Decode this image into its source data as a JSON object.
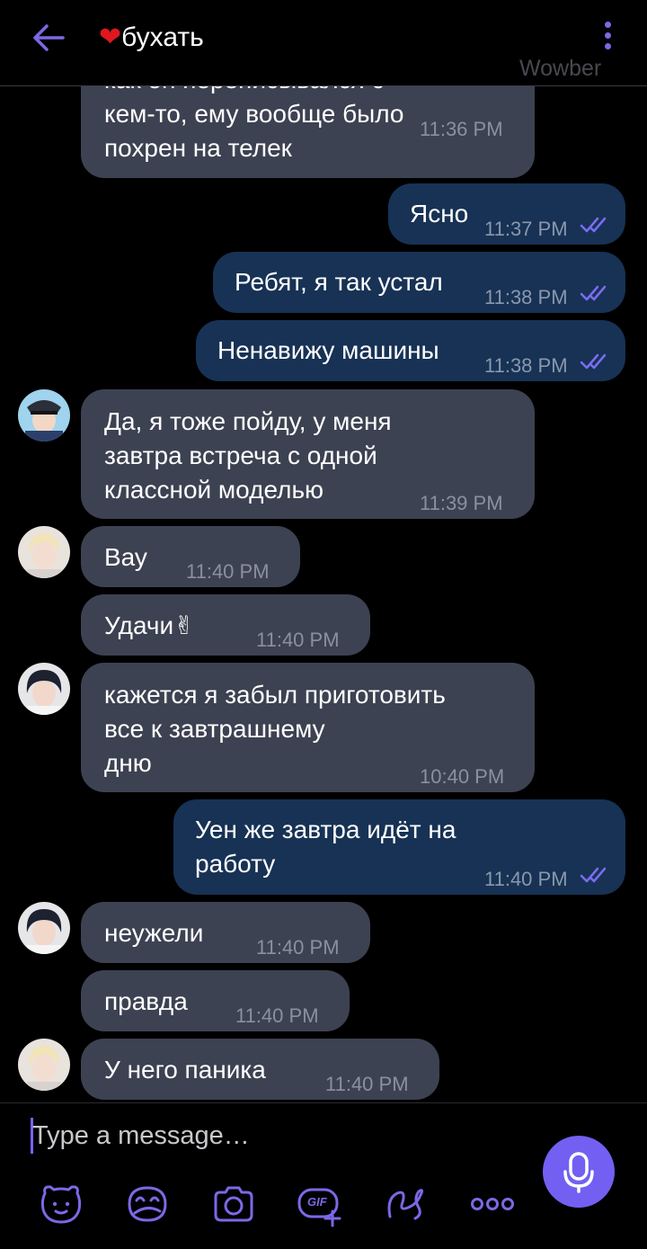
{
  "header": {
    "back_icon": "arrow-left-icon",
    "heart": "❤",
    "title": "бухать",
    "menu_icon": "vertical-dots-icon",
    "watermark": "Wowber"
  },
  "colors": {
    "accent": "#7360f2",
    "incoming_bubble": "#3d4252",
    "outgoing_bubble": "#173254",
    "background": "#000000"
  },
  "messages": [
    {
      "dir": "in",
      "text": "как он переписывался с\nкем-то, ему вообще было\nпохрен на телек",
      "time": "11:36 PM"
    },
    {
      "dir": "out",
      "text": "Ясно",
      "time": "11:37 PM",
      "status": "read"
    },
    {
      "dir": "out",
      "text": "Ребят, я так устал",
      "time": "11:38 PM",
      "status": "read"
    },
    {
      "dir": "out",
      "text": "Ненавижу машины",
      "time": "11:38 PM",
      "status": "read"
    },
    {
      "dir": "in",
      "text": "Да, я тоже пойду, у меня\nзавтра встреча с одной\nклассной моделью",
      "time": "11:39 PM",
      "avatar": "avatar-police-cap"
    },
    {
      "dir": "in",
      "text": "Вау",
      "time": "11:40 PM",
      "avatar": "avatar-blond"
    },
    {
      "dir": "in",
      "text": "Удачи✌",
      "time": "11:40 PM"
    },
    {
      "dir": "in",
      "text": "кажется я забыл приготовить\nвсе к завтрашнему\nдню",
      "time": "10:40 PM",
      "avatar": "avatar-dark-hair"
    },
    {
      "dir": "out",
      "text": "Уен же завтра идёт на\nработу",
      "time": "11:40 PM",
      "status": "read"
    },
    {
      "dir": "in",
      "text": "неужели",
      "time": "11:40 PM",
      "avatar": "avatar-dark-hair"
    },
    {
      "dir": "in",
      "text": "правда",
      "time": "11:40 PM"
    },
    {
      "dir": "in",
      "text": "У него паника",
      "time": "11:40 PM",
      "avatar": "avatar-blond"
    }
  ],
  "composer": {
    "placeholder": "Type a message…",
    "mic_icon": "microphone-icon",
    "toolbar": [
      "sticker-bear-icon",
      "doodle-icon",
      "camera-icon",
      "gif-icon",
      "draw-loop-icon",
      "more-dots-icon"
    ],
    "gif_label": "GIF"
  }
}
